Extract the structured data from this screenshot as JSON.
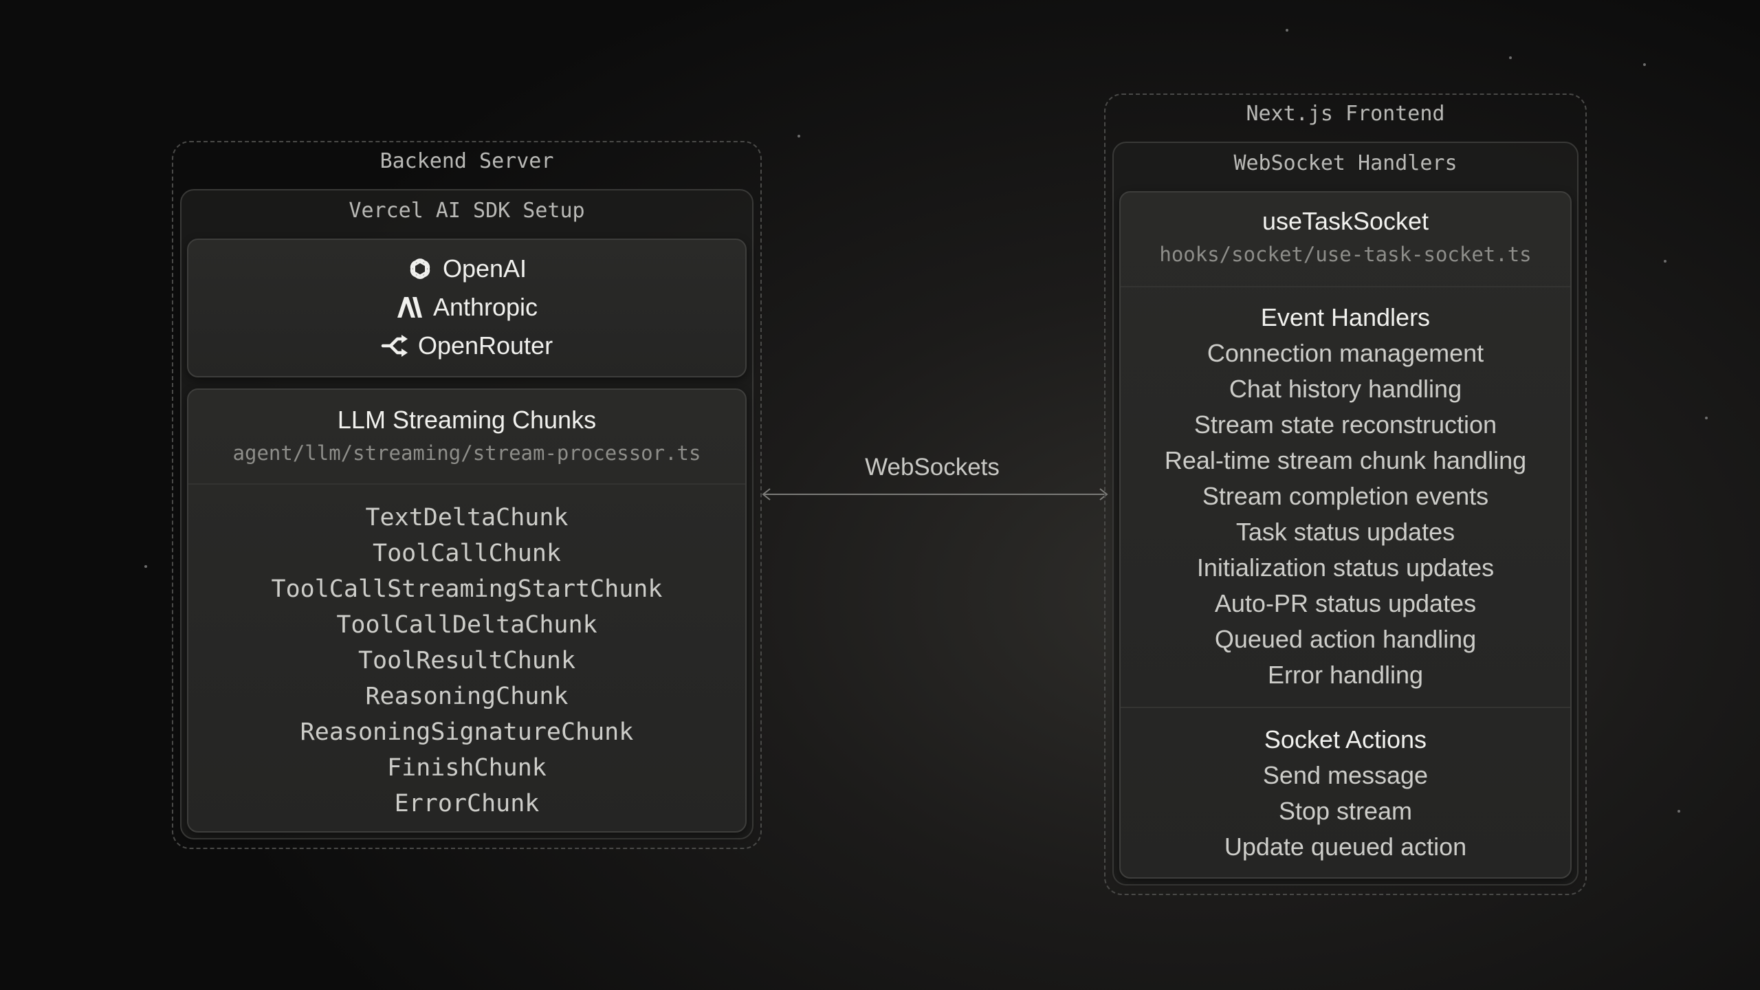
{
  "backend": {
    "title": "Backend Server",
    "sdk_title": "Vercel AI SDK Setup",
    "providers": [
      {
        "icon": "openai-icon",
        "label": "OpenAI"
      },
      {
        "icon": "anthropic-icon",
        "label": "Anthropic"
      },
      {
        "icon": "openrouter-icon",
        "label": "OpenRouter"
      }
    ],
    "streaming": {
      "title": "LLM Streaming Chunks",
      "path": "agent/llm/streaming/stream-processor.ts",
      "chunks": [
        "TextDeltaChunk",
        "ToolCallChunk",
        "ToolCallStreamingStartChunk",
        "ToolCallDeltaChunk",
        "ToolResultChunk",
        "ReasoningChunk",
        "ReasoningSignatureChunk",
        "FinishChunk",
        "ErrorChunk"
      ]
    }
  },
  "connection": {
    "label": "WebSockets"
  },
  "frontend": {
    "title": "Next.js Frontend",
    "handlers_title": "WebSocket Handlers",
    "hook": {
      "name": "useTaskSocket",
      "path": "hooks/socket/use-task-socket.ts"
    },
    "event_handlers": {
      "title": "Event Handlers",
      "items": [
        "Connection management",
        "Chat history handling",
        "Stream state reconstruction",
        "Real-time stream chunk handling",
        "Stream completion events",
        "Task status updates",
        "Initialization status updates",
        "Auto-PR status updates",
        "Queued action handling",
        "Error handling"
      ]
    },
    "socket_actions": {
      "title": "Socket Actions",
      "items": [
        "Send message",
        "Stop stream",
        "Update queued action"
      ]
    }
  }
}
